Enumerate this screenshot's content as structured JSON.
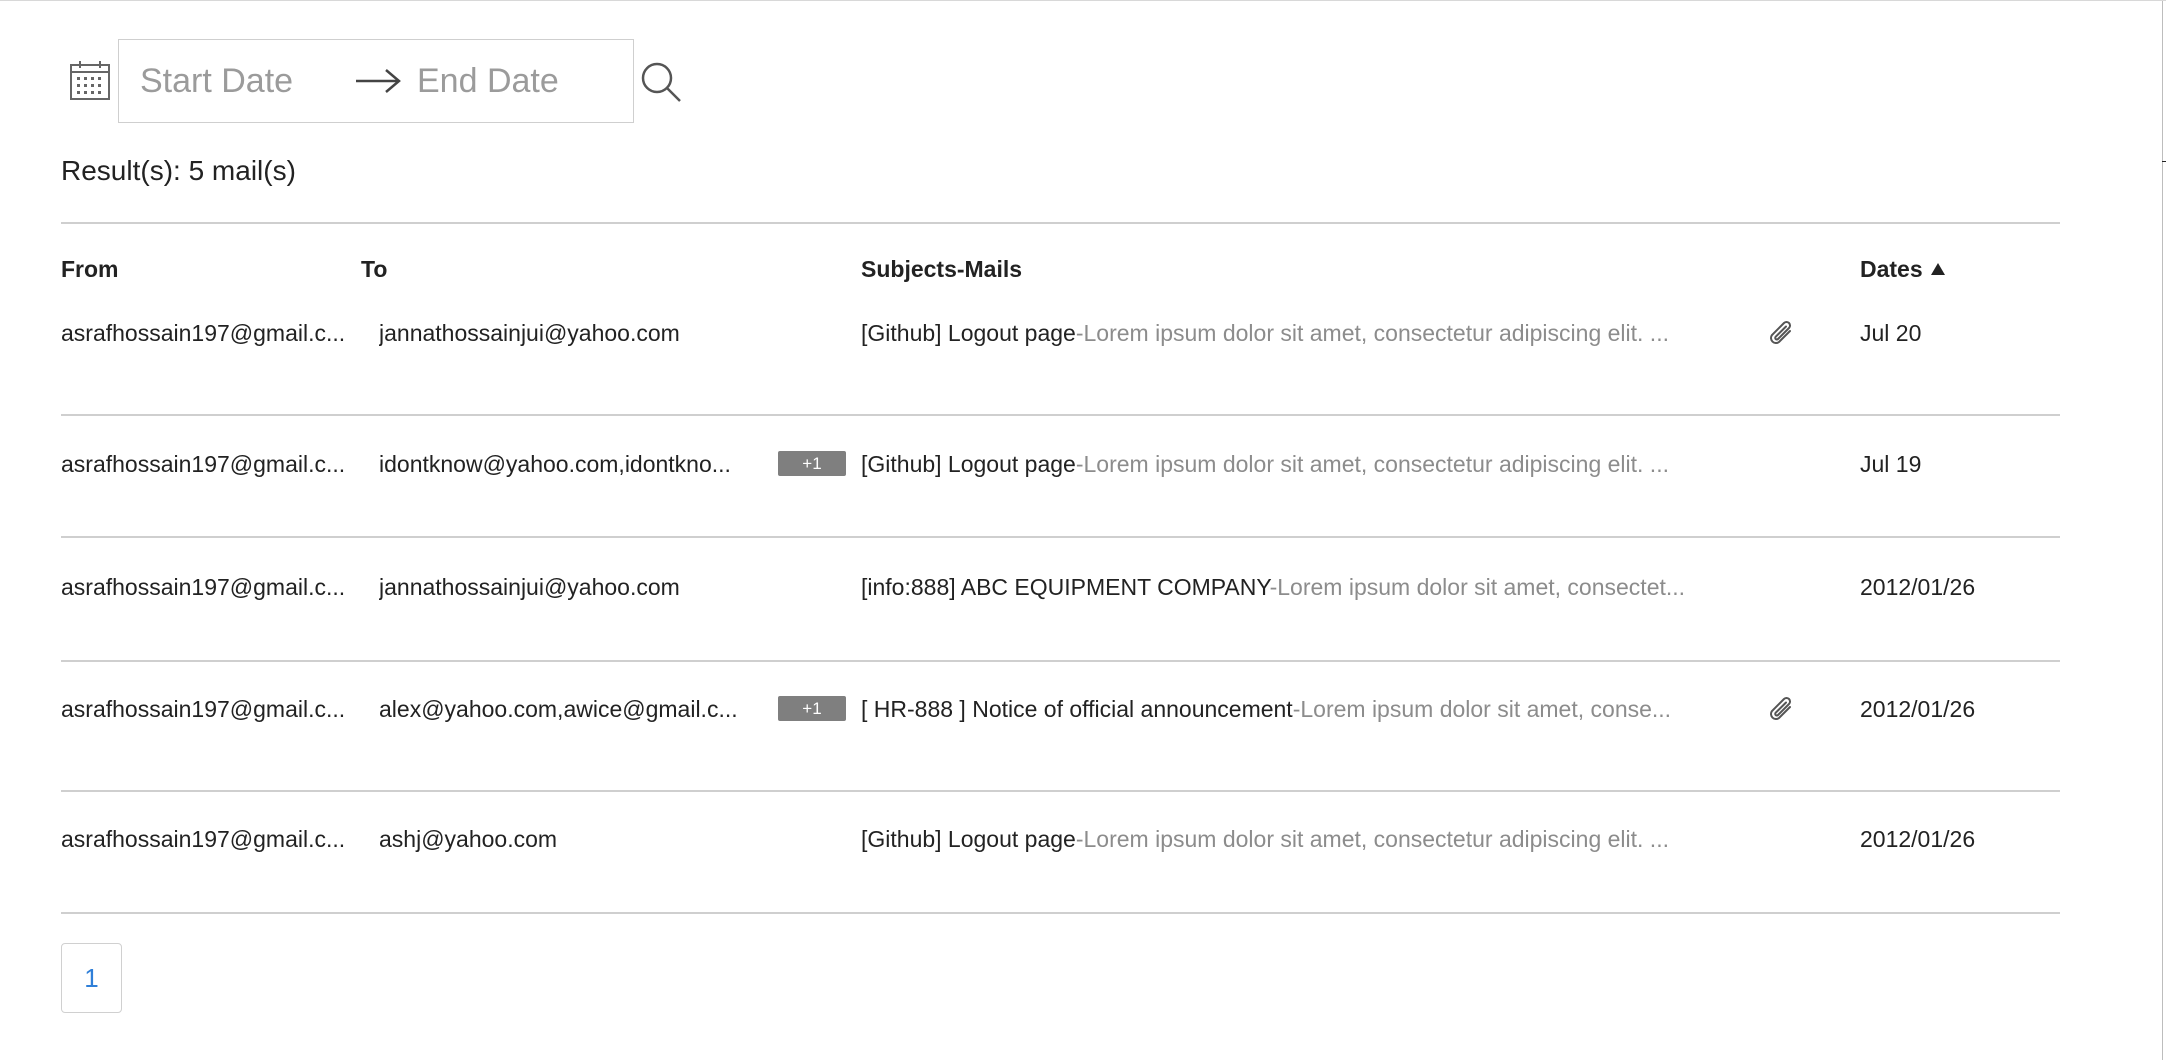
{
  "filter": {
    "start_placeholder": "Start Date",
    "end_placeholder": "End Date",
    "calendar_icon": "calendar-icon",
    "arrow_icon": "arrow-right-icon",
    "search_icon": "search-icon"
  },
  "result": {
    "text": "Result(s): 5 mail(s)"
  },
  "table": {
    "headers": {
      "from": "From",
      "to": "To",
      "subject": "Subjects-Mails",
      "dates": "Dates"
    },
    "sort": "ascending",
    "rows": [
      {
        "from": "asrafhossain197@gmail.c...",
        "to": "jannathossainjui@yahoo.com",
        "badge": "",
        "subject": "[Github] Logout page",
        "preview": "-Lorem ipsum dolor sit amet, consectetur adipiscing elit. ...",
        "attachment": true,
        "date": "Jul 20"
      },
      {
        "from": "asrafhossain197@gmail.c...",
        "to": "idontknow@yahoo.com,idontkno...",
        "badge": "+1",
        "subject": "[Github] Logout page",
        "preview": "-Lorem ipsum dolor sit amet, consectetur adipiscing elit. ...",
        "attachment": false,
        "date": "Jul 19"
      },
      {
        "from": "asrafhossain197@gmail.c...",
        "to": "jannathossainjui@yahoo.com",
        "badge": "",
        "subject": "[info:888] ABC EQUIPMENT COMPANY",
        "preview": "-Lorem ipsum dolor sit amet, consectet...",
        "attachment": false,
        "date": "2012/01/26"
      },
      {
        "from": "asrafhossain197@gmail.c...",
        "to": "alex@yahoo.com,awice@gmail.c...",
        "badge": "+1",
        "subject": "[ HR-888 ] Notice of official announcement",
        "preview": "-Lorem ipsum dolor sit amet, conse...",
        "attachment": true,
        "date": "2012/01/26"
      },
      {
        "from": "asrafhossain197@gmail.c...",
        "to": "ashj@yahoo.com",
        "badge": "",
        "subject": "[Github] Logout page",
        "preview": "-Lorem ipsum dolor sit amet, consectetur adipiscing elit. ...",
        "attachment": false,
        "date": "2012/01/26"
      }
    ]
  },
  "pagination": {
    "current": "1"
  },
  "colors": {
    "page_link": "#2f7fd8",
    "preview_text": "#8c8c8c",
    "badge_bg": "#7f7f7f",
    "divider": "#cfcfcf"
  }
}
